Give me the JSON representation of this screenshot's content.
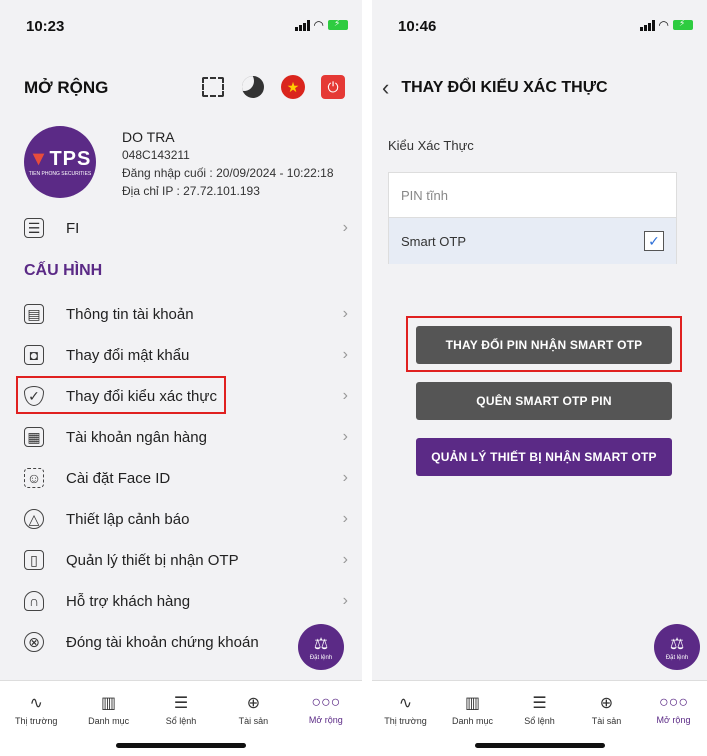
{
  "left": {
    "time": "10:23",
    "title": "MỞ RỘNG",
    "profile": {
      "logo_text": "TPS",
      "logo_sub": "TIEN PHONG SECURITIES",
      "name": "DO TRA",
      "account": "048C143211",
      "last_login": "Đăng nhập cuối : 20/09/2024 - 10:22:18",
      "ip": "Địa chỉ IP : 27.72.101.193"
    },
    "fi_item": "FI",
    "section_title": "CẤU HÌNH",
    "items": [
      {
        "label": "Thông tin tài khoản",
        "icon": "id-card-icon"
      },
      {
        "label": "Thay đổi mật khẩu",
        "icon": "lock-icon"
      },
      {
        "label": "Thay đổi kiểu xác thực",
        "icon": "shield-check-icon"
      },
      {
        "label": "Tài khoản ngân hàng",
        "icon": "bank-icon"
      },
      {
        "label": "Cài đặt Face ID",
        "icon": "face-id-icon"
      },
      {
        "label": "Thiết lập cảnh báo",
        "icon": "bell-icon"
      },
      {
        "label": "Quản lý thiết bị nhận OTP",
        "icon": "device-icon"
      },
      {
        "label": "Hỗ trợ khách hàng",
        "icon": "headset-icon"
      },
      {
        "label": "Đóng tài khoản chứng khoán",
        "icon": "close-account-icon"
      }
    ],
    "fab_label": "Đặt lệnh"
  },
  "right": {
    "time": "10:46",
    "title": "THAY ĐỔI KIỂU XÁC THỰC",
    "field_label": "Kiểu Xác Thực",
    "options": [
      "PIN tĩnh",
      "Smart OTP"
    ],
    "selected_option": "Smart OTP",
    "buttons": {
      "change_pin": "THAY ĐỔI PIN NHẬN SMART OTP",
      "forgot_pin": "QUÊN SMART OTP PIN",
      "manage_devices": "QUẢN LÝ THIẾT BỊ NHẬN SMART OTP"
    },
    "fab_label": "Đặt lệnh"
  },
  "tabs": [
    "Thị trường",
    "Danh mục",
    "Sổ lệnh",
    "Tài sản",
    "Mở rộng"
  ],
  "active_tab": "Mở rộng",
  "colors": {
    "brand": "#5b2a86",
    "highlight": "#e02020",
    "button_gray": "#555555"
  }
}
